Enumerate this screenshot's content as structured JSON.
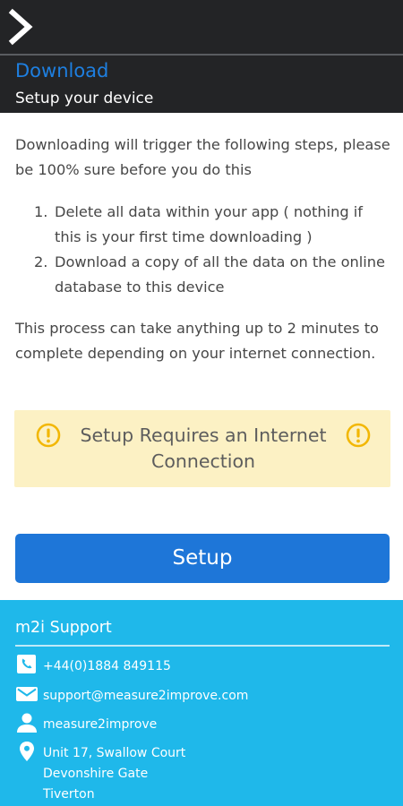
{
  "header": {
    "title": "Download",
    "subtitle": "Setup your device"
  },
  "content": {
    "intro": "Downloading will trigger the following steps, please be 100% sure before you do this",
    "steps": [
      {
        "num": "1.",
        "text": "Delete all data within your app ( nothing if this is your first time downloading )"
      },
      {
        "num": "2.",
        "text": "Download a copy of all the data on the online database to this device"
      }
    ],
    "process_note": "This process can take anything up to 2 minutes to complete depending on your internet connection."
  },
  "warning": {
    "text": "Setup Requires an Internet Connection",
    "icon": "exclamation-circle-icon",
    "icon_color": "#f2b705",
    "background": "#fcf1c4"
  },
  "setup_button": {
    "label": "Setup",
    "color": "#1e76d8"
  },
  "footer": {
    "title": "m2i Support",
    "background": "#1fb8ea",
    "phone": "+44(0)1884 849115",
    "email": "support@measure2improve.com",
    "username": "measure2improve",
    "address_lines": [
      "Unit 17, Swallow Court",
      "Devonshire Gate",
      "Tiverton"
    ]
  },
  "colors": {
    "topbar": "#232426",
    "title_blue": "#1e7fe0"
  }
}
